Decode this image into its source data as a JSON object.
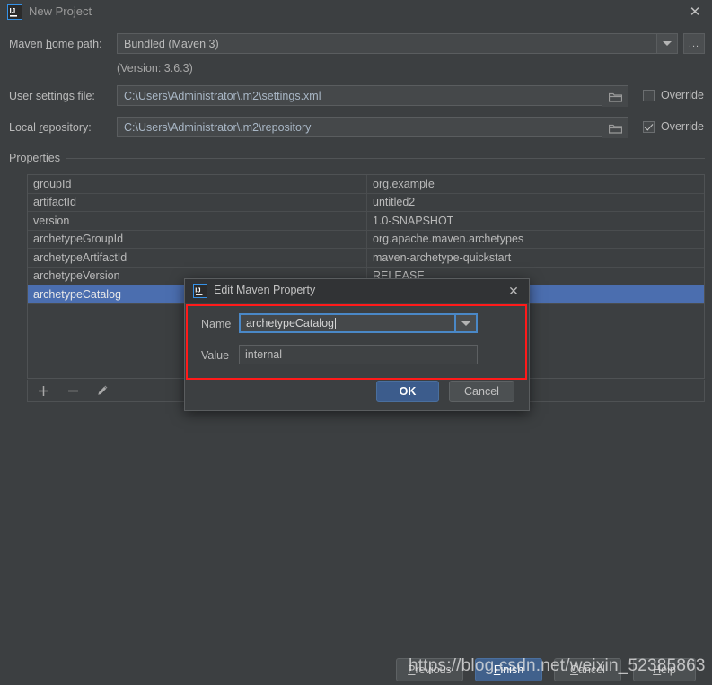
{
  "window": {
    "title": "New Project",
    "logo_icon": "intellij-idea-icon",
    "close_icon": "close-icon"
  },
  "form": {
    "maven_home": {
      "label_pre": "Maven ",
      "label_accel": "h",
      "label_post": "ome path:",
      "value": "Bundled (Maven 3)",
      "dropdown_icon": "chevron-down-icon",
      "browse_label": "...",
      "version_note": "(Version: 3.6.3)"
    },
    "user_settings": {
      "label_pre": "User ",
      "label_accel": "s",
      "label_post": "ettings file:",
      "value": "C:\\Users\\Administrator\\.m2\\settings.xml",
      "folder_icon": "folder-icon",
      "override_label": "Override",
      "override_checked": false
    },
    "local_repository": {
      "label_pre": "Local ",
      "label_accel": "r",
      "label_post": "epository:",
      "value": "C:\\Users\\Administrator\\.m2\\repository",
      "folder_icon": "folder-icon",
      "override_label": "Override",
      "override_checked": true
    }
  },
  "properties": {
    "section_label": "Properties",
    "rows": [
      {
        "name": "groupId",
        "value": "org.example",
        "selected": false
      },
      {
        "name": "artifactId",
        "value": "untitled2",
        "selected": false
      },
      {
        "name": "version",
        "value": "1.0-SNAPSHOT",
        "selected": false
      },
      {
        "name": "archetypeGroupId",
        "value": "org.apache.maven.archetypes",
        "selected": false
      },
      {
        "name": "archetypeArtifactId",
        "value": "maven-archetype-quickstart",
        "selected": false
      },
      {
        "name": "archetypeVersion",
        "value": "RELEASE",
        "selected": false
      },
      {
        "name": "archetypeCatalog",
        "value": "",
        "selected": true
      }
    ],
    "toolbar": {
      "add_icon": "plus-icon",
      "remove_icon": "minus-icon",
      "edit_icon": "pencil-icon"
    }
  },
  "footer": {
    "previous": {
      "pre": "",
      "accel": "P",
      "post": "revious"
    },
    "finish": {
      "pre": "",
      "accel": "F",
      "post": "inish"
    },
    "cancel": {
      "pre": "",
      "accel": "C",
      "post": "ancel"
    },
    "help": {
      "pre": "",
      "accel": "H",
      "post": "elp"
    }
  },
  "watermark": {
    "text": "https://blog.csdn.net/weixin_52385863"
  },
  "dialog": {
    "title": "Edit Maven Property",
    "logo_icon": "intellij-idea-icon",
    "close_icon": "close-icon",
    "name_label": "Name",
    "name_value": "archetypeCatalog",
    "name_dropdown_icon": "chevron-down-icon",
    "value_label": "Value",
    "value_value": "internal",
    "ok_label": "OK",
    "cancel_label": "Cancel",
    "highlight_color": "#ff1a1a"
  },
  "colors": {
    "background": "#3c3f41",
    "selection": "#4b6eaf",
    "accent": "#3c5c8c",
    "field": "#45484a",
    "text": "#bbbbbb",
    "path_text": "#a9b7c6"
  }
}
